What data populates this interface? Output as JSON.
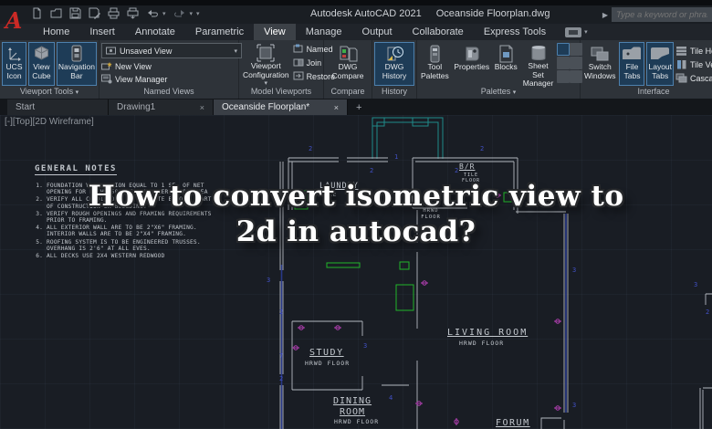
{
  "window": {
    "app_title": "Autodesk AutoCAD 2021",
    "doc_title": "Oceanside Floorplan.dwg",
    "search_placeholder": "Type a keyword or phrase"
  },
  "ribbon": {
    "tabs": [
      "Home",
      "Insert",
      "Annotate",
      "Parametric",
      "View",
      "Manage",
      "Output",
      "Collaborate",
      "Express Tools"
    ],
    "active_tab": "View",
    "viewport_tools": {
      "label": "Viewport Tools",
      "ucs": "UCS Icon",
      "cube": "View Cube",
      "navbar": "Navigation Bar"
    },
    "named_views": {
      "label": "Named Views",
      "dropdown_value": "Unsaved View",
      "new_view": "New View",
      "view_manager": "View Manager"
    },
    "model_viewports": {
      "label": "Model Viewports",
      "config": "Viewport Configuration",
      "named": "Named",
      "join": "Join",
      "restore": "Restore"
    },
    "compare": {
      "label": "Compare",
      "button": "DWG Compare"
    },
    "history": {
      "label": "History",
      "button": "DWG History"
    },
    "palettes": {
      "label": "Palettes",
      "tool_palettes": "Tool Palettes",
      "properties": "Properties",
      "blocks": "Blocks",
      "sheet_set": "Sheet Set Manager"
    },
    "interface": {
      "label": "Interface",
      "switch_windows": "Switch Windows",
      "file_tabs": "File Tabs",
      "layout_tabs": "Layout Tabs",
      "tile_h": "Tile Horizontally",
      "tile_v": "Tile Vertically",
      "cascade": "Cascade"
    }
  },
  "file_tabs": {
    "start": "Start",
    "drawing1": "Drawing1",
    "active": "Oceanside Floorplan*",
    "close": "×",
    "new_tab": "+"
  },
  "canvas": {
    "viewport_controls": "[-][Top][2D Wireframe]",
    "notes": {
      "heading": "GENERAL NOTES",
      "items": [
        "FOUNDATION VENTILATION EQUAL TO 1 SF. OF NET OPENING FOR EACH 150 S.F. OF UNDER FLOOR AREA",
        "VERIFY ALL CONDITIONS AT THE SITE BEFORE START OF CONSTRUCTION OR BUILDING.",
        "VERIFY ROUGH OPENINGS AND FRAMING REQUIREMENTS PRIOR TO FRAMING.",
        "ALL EXTERIOR WALL ARE TO BE 2\"X6\" FRAMING. INTERIOR WALLS ARE TO BE 2\"X4\" FRAMING.",
        "ROOFING SYSTEM IS TO BE ENGINEERED TRUSSES. OVERHANG IS 2'6\" AT ALL EVES.",
        "ALL DECKS USE 2X4 WESTERN REDWOOD"
      ]
    },
    "rooms": {
      "laundry": {
        "name": "LAUNDRY",
        "floor": "TILE"
      },
      "br": {
        "name": "B/R",
        "floor": "TILE FLOOR"
      },
      "kitchen_floor": "HRWD FLOOR",
      "living": {
        "name": "LIVING ROOM",
        "floor": "HRWD FLOOR"
      },
      "study": {
        "name": "STUDY",
        "floor": "HRWD FLOOR"
      },
      "dining": {
        "name": "DINING ROOM",
        "floor": "HRWD FLOOR"
      },
      "forum": {
        "name": "FORUM"
      }
    },
    "markers": [
      "2",
      "1",
      "2",
      "2",
      "2",
      "3",
      "2",
      "7",
      "2",
      "3",
      "4",
      "3",
      "3",
      "3",
      "2"
    ]
  },
  "overlay": {
    "line1": "How to convert isometric view to",
    "line2": "2d in autocad?"
  },
  "colors": {
    "highlight_bg": "#1e3c57",
    "highlight_border": "#4d80ad",
    "wall_gray": "#b4b9bf",
    "teal": "#1f8a8a",
    "green": "#21b52a",
    "magenta": "#b33fb3",
    "marker_blue": "#4150c5",
    "overlay_text": "#ffffff",
    "canvas_bg": "#191d24"
  }
}
